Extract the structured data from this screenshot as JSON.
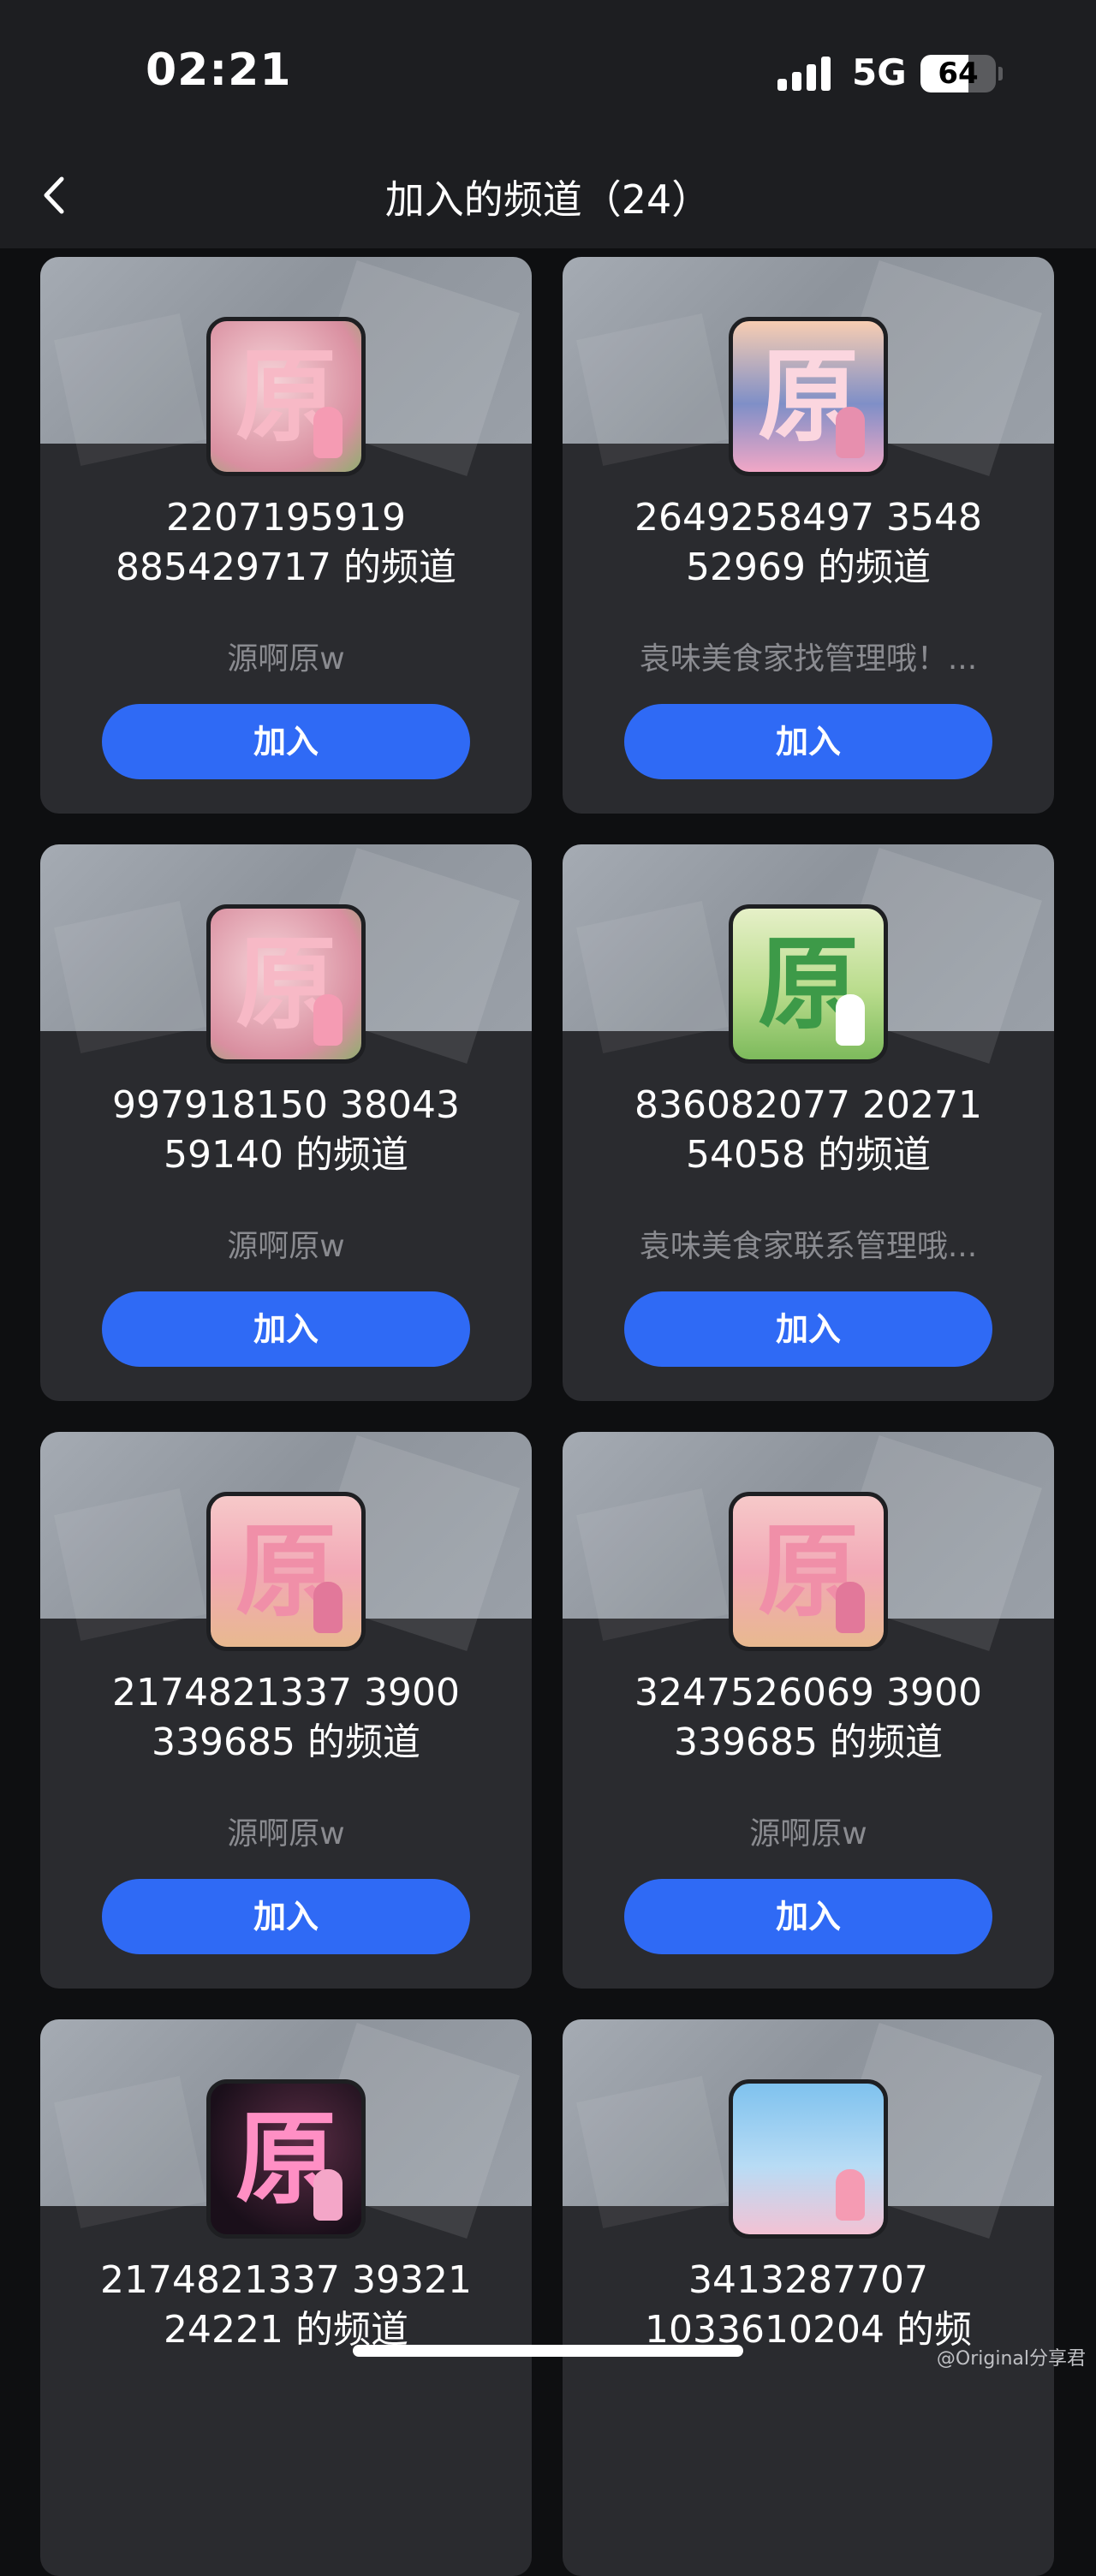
{
  "status": {
    "time": "02:21",
    "network": "5G",
    "battery": "64",
    "battery_level": 0.64
  },
  "nav": {
    "title": "加入的频道（24）",
    "back_icon": "chevron-left-icon"
  },
  "colors": {
    "accent": "#2f6af5",
    "card": "#2a2b2f",
    "background": "#0e0f11"
  },
  "channels": [
    {
      "title": "2207195919 885429717 的频道",
      "owner": "源啊原w",
      "button": "加入",
      "avatar_char": "原",
      "avatar_style": "pink-floral"
    },
    {
      "title": "2649258497 3548 52969 的频道",
      "owner": "袁味美食家找管理哦！...",
      "button": "加入",
      "avatar_char": "原",
      "avatar_style": "pink-sky"
    },
    {
      "title": "997918150 38043 59140 的频道",
      "owner": "源啊原w",
      "button": "加入",
      "avatar_char": "原",
      "avatar_style": "pink-floral"
    },
    {
      "title": "836082077 20271 54058 的频道",
      "owner": "袁味美食家联系管理哦...",
      "button": "加入",
      "avatar_char": "原",
      "avatar_style": "green-meadow"
    },
    {
      "title": "2174821337 3900 339685 的频道",
      "owner": "源啊原w",
      "button": "加入",
      "avatar_char": "原",
      "avatar_style": "pink-sunset"
    },
    {
      "title": "3247526069 3900 339685 的频道",
      "owner": "源啊原w",
      "button": "加入",
      "avatar_char": "原",
      "avatar_style": "pink-sunset"
    },
    {
      "title": "2174821337 39321 24221 的频道",
      "owner": "",
      "button": "",
      "avatar_char": "原",
      "avatar_style": "night-glow"
    },
    {
      "title": "3413287707 1033610204 的频",
      "owner": "",
      "button": "",
      "avatar_char": "",
      "avatar_style": "cloud-sky"
    }
  ],
  "watermark": "@Original分享君"
}
